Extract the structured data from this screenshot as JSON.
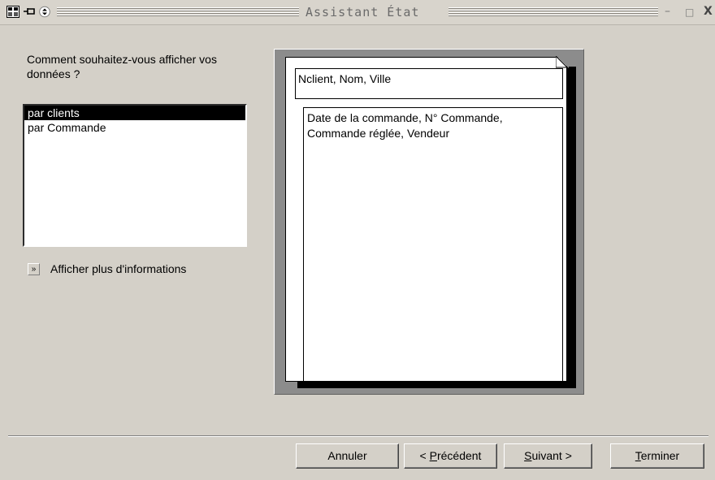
{
  "window": {
    "title": "Assistant État",
    "minimize_icon": "minimize-icon",
    "restore_icon": "restore-icon",
    "close_icon": "close-icon"
  },
  "prompt": "Comment souhaitez-vous afficher vos données ?",
  "list": {
    "items": [
      "par clients",
      "par Commande"
    ],
    "selected": "par clients"
  },
  "more_info": {
    "label": "Afficher plus d'informations",
    "icon": "double-chevron-right-icon"
  },
  "preview": {
    "header_fields": "Nclient, Nom, Ville",
    "detail_fields": "Date de la commande, N° Commande, Commande réglée, Vendeur"
  },
  "buttons": {
    "cancel": "Annuler",
    "previous": {
      "prefix": "< ",
      "accel": "P",
      "rest": "récédent"
    },
    "next": {
      "accel": "S",
      "rest": "uivant",
      "suffix": " >"
    },
    "finish": {
      "accel": "T",
      "rest": "erminer"
    }
  }
}
